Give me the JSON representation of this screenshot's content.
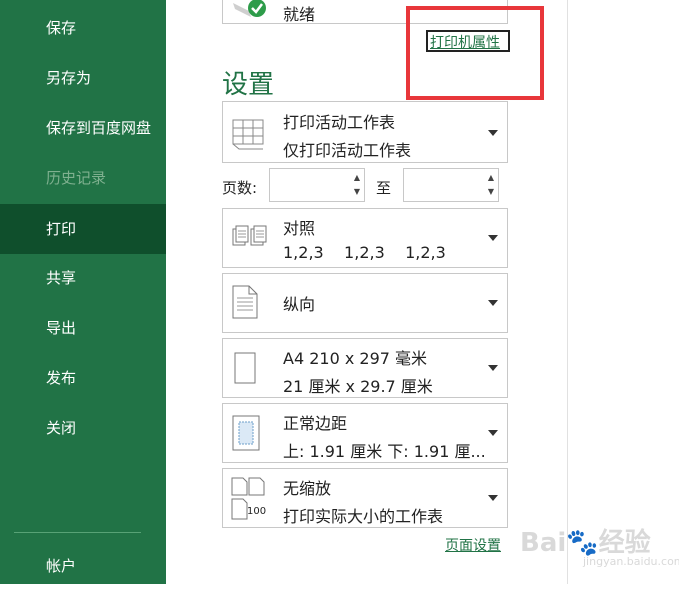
{
  "sidebar": {
    "items": [
      {
        "label": "保存"
      },
      {
        "label": "另存为"
      },
      {
        "label": "保存到百度网盘"
      },
      {
        "label": "历史记录"
      },
      {
        "label": "打印"
      },
      {
        "label": "共享"
      },
      {
        "label": "导出"
      },
      {
        "label": "发布"
      },
      {
        "label": "关闭"
      }
    ],
    "account": "帐户"
  },
  "printer": {
    "status": "就绪",
    "properties_link": "打印机属性"
  },
  "settings": {
    "heading": "设置",
    "scope": {
      "line1": "打印活动工作表",
      "line2": "仅打印活动工作表"
    },
    "pages": {
      "label": "页数:",
      "to": "至",
      "from_value": "",
      "to_value": ""
    },
    "collate": {
      "line1": "对照",
      "line2": "1,2,3    1,2,3    1,2,3"
    },
    "orientation": {
      "line1": "纵向"
    },
    "paper": {
      "line1": "A4 210 x 297 毫米",
      "line2": "21 厘米 x 29.7 厘米"
    },
    "margins": {
      "line1": "正常边距",
      "line2": "上: 1.91 厘米 下: 1.91 厘..."
    },
    "scaling": {
      "line1": "无缩放",
      "line2": "打印实际大小的工作表",
      "icon_text": "100"
    },
    "page_setup_link": "页面设置"
  },
  "watermark": {
    "text": "Bai🐾经验",
    "sub": "jingyan.baidu.com"
  },
  "colors": {
    "accent": "#217346",
    "sidebar_active": "#0f4f2c",
    "highlight": "#e8363a"
  }
}
